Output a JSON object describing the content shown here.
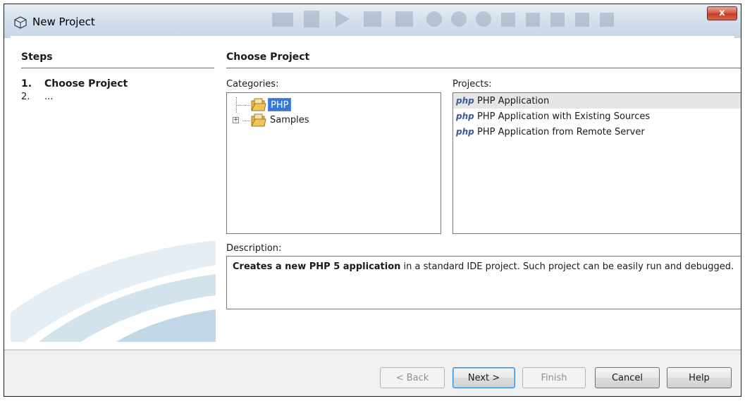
{
  "window": {
    "title": "New Project",
    "close_label": "x",
    "icon": "cube-icon"
  },
  "steps": {
    "header": "Steps",
    "items": [
      {
        "num": "1.",
        "label": "Choose Project"
      },
      {
        "num": "2.",
        "label": "..."
      }
    ]
  },
  "main": {
    "header": "Choose Project",
    "categories_label": "Categories:",
    "projects_label": "Projects:",
    "description_label": "Description:",
    "categories": [
      {
        "label": "PHP",
        "selected": true,
        "icon": "folder-icon"
      },
      {
        "label": "Samples",
        "selected": false,
        "expandable": true,
        "icon": "folder-icon"
      }
    ],
    "projects": [
      {
        "icon_text": "php",
        "label": "PHP Application",
        "selected": true
      },
      {
        "icon_text": "php",
        "label": "PHP Application with Existing Sources",
        "selected": false
      },
      {
        "icon_text": "php",
        "label": "PHP Application from Remote Server",
        "selected": false
      }
    ],
    "description_bold": "Creates a new PHP 5 application",
    "description_rest": " in a standard IDE project. Such project can be easily run and debugged."
  },
  "buttons": {
    "back": "< Back",
    "next": "Next >",
    "finish": "Finish",
    "cancel": "Cancel",
    "help": "Help"
  },
  "colors": {
    "selection": "#3877d8",
    "title_bar": "#d5e0ec",
    "close_button": "#c23a24",
    "footer": "#f0f0f0"
  }
}
